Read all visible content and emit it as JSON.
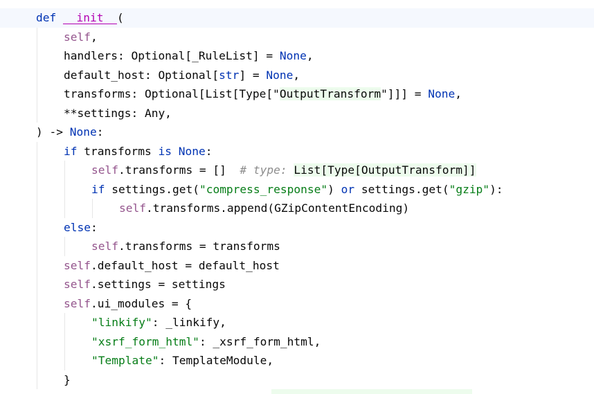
{
  "editor": {
    "language": "Python",
    "lines": [
      {
        "indent": 0,
        "tokens": [
          {
            "t": "def ",
            "c": "kw"
          },
          {
            "t": "__init__",
            "c": "dunder"
          },
          {
            "t": "(",
            "c": "op"
          }
        ]
      },
      {
        "indent": 1,
        "tokens": [
          {
            "t": "self",
            "c": "self"
          },
          {
            "t": ",",
            "c": "op"
          }
        ]
      },
      {
        "indent": 1,
        "tokens": [
          {
            "t": "handlers: Optional[_RuleList] = ",
            "c": "op"
          },
          {
            "t": "None",
            "c": "kw"
          },
          {
            "t": ",",
            "c": "op"
          }
        ]
      },
      {
        "indent": 1,
        "tokens": [
          {
            "t": "default_host: Optional[",
            "c": "op"
          },
          {
            "t": "str",
            "c": "kw"
          },
          {
            "t": "] = ",
            "c": "op"
          },
          {
            "t": "None",
            "c": "kw"
          },
          {
            "t": ",",
            "c": "op"
          }
        ]
      },
      {
        "indent": 1,
        "tokens": [
          {
            "t": "transforms: Optional[List[Type[\"",
            "c": "op"
          },
          {
            "t": "OutputTransform",
            "c": "str-hl"
          },
          {
            "t": "\"]]] = ",
            "c": "op"
          },
          {
            "t": "None",
            "c": "kw"
          },
          {
            "t": ",",
            "c": "op"
          }
        ]
      },
      {
        "indent": 1,
        "tokens": [
          {
            "t": "**settings: Any,",
            "c": "op"
          }
        ]
      },
      {
        "indent": 0,
        "tokens": [
          {
            "t": ") -> ",
            "c": "op"
          },
          {
            "t": "None",
            "c": "kw"
          },
          {
            "t": ":",
            "c": "op"
          }
        ]
      },
      {
        "indent": 1,
        "tokens": [
          {
            "t": "if ",
            "c": "kw"
          },
          {
            "t": "transforms ",
            "c": "op"
          },
          {
            "t": "is ",
            "c": "kw"
          },
          {
            "t": "None",
            "c": "kw"
          },
          {
            "t": ":",
            "c": "op"
          }
        ]
      },
      {
        "indent": 2,
        "tokens": [
          {
            "t": "self",
            "c": "self"
          },
          {
            "t": ".transforms = []  ",
            "c": "op"
          },
          {
            "t": "# type: ",
            "c": "cmt"
          },
          {
            "t": "List[Type[OutputTransform]]",
            "c": "cmt-hl"
          }
        ]
      },
      {
        "indent": 2,
        "tokens": [
          {
            "t": "if ",
            "c": "kw"
          },
          {
            "t": "settings.get(",
            "c": "op"
          },
          {
            "t": "\"compress_response\"",
            "c": "str"
          },
          {
            "t": ") ",
            "c": "op"
          },
          {
            "t": "or ",
            "c": "kw"
          },
          {
            "t": "settings.get(",
            "c": "op"
          },
          {
            "t": "\"gzip\"",
            "c": "str"
          },
          {
            "t": "):",
            "c": "op"
          }
        ]
      },
      {
        "indent": 3,
        "tokens": [
          {
            "t": "self",
            "c": "self"
          },
          {
            "t": ".transforms.append(GZipContentEncoding)",
            "c": "op"
          }
        ]
      },
      {
        "indent": 1,
        "tokens": [
          {
            "t": "else",
            "c": "kw"
          },
          {
            "t": ":",
            "c": "op"
          }
        ]
      },
      {
        "indent": 2,
        "tokens": [
          {
            "t": "self",
            "c": "self"
          },
          {
            "t": ".transforms = transforms",
            "c": "op"
          }
        ]
      },
      {
        "indent": 1,
        "tokens": [
          {
            "t": "self",
            "c": "self"
          },
          {
            "t": ".default_host = default_host",
            "c": "op"
          }
        ]
      },
      {
        "indent": 1,
        "tokens": [
          {
            "t": "self",
            "c": "self"
          },
          {
            "t": ".settings = settings",
            "c": "op"
          }
        ]
      },
      {
        "indent": 1,
        "tokens": [
          {
            "t": "self",
            "c": "self"
          },
          {
            "t": ".ui_modules = {",
            "c": "op"
          }
        ]
      },
      {
        "indent": 2,
        "tokens": [
          {
            "t": "\"linkify\"",
            "c": "str"
          },
          {
            "t": ": _linkify,",
            "c": "op"
          }
        ]
      },
      {
        "indent": 2,
        "tokens": [
          {
            "t": "\"xsrf_form_html\"",
            "c": "str"
          },
          {
            "t": ": _xsrf_form_html,",
            "c": "op"
          }
        ]
      },
      {
        "indent": 2,
        "tokens": [
          {
            "t": "\"Template\"",
            "c": "str"
          },
          {
            "t": ": TemplateModule,",
            "c": "op"
          }
        ]
      },
      {
        "indent": 1,
        "tokens": [
          {
            "t": "}",
            "c": "op"
          }
        ]
      }
    ]
  },
  "theme": {
    "keyword": "#0033b3",
    "self": "#94558d",
    "string": "#067d17",
    "comment": "#8c8c8c",
    "highlight": "#edfced",
    "current_line": "#f5f8fe"
  }
}
